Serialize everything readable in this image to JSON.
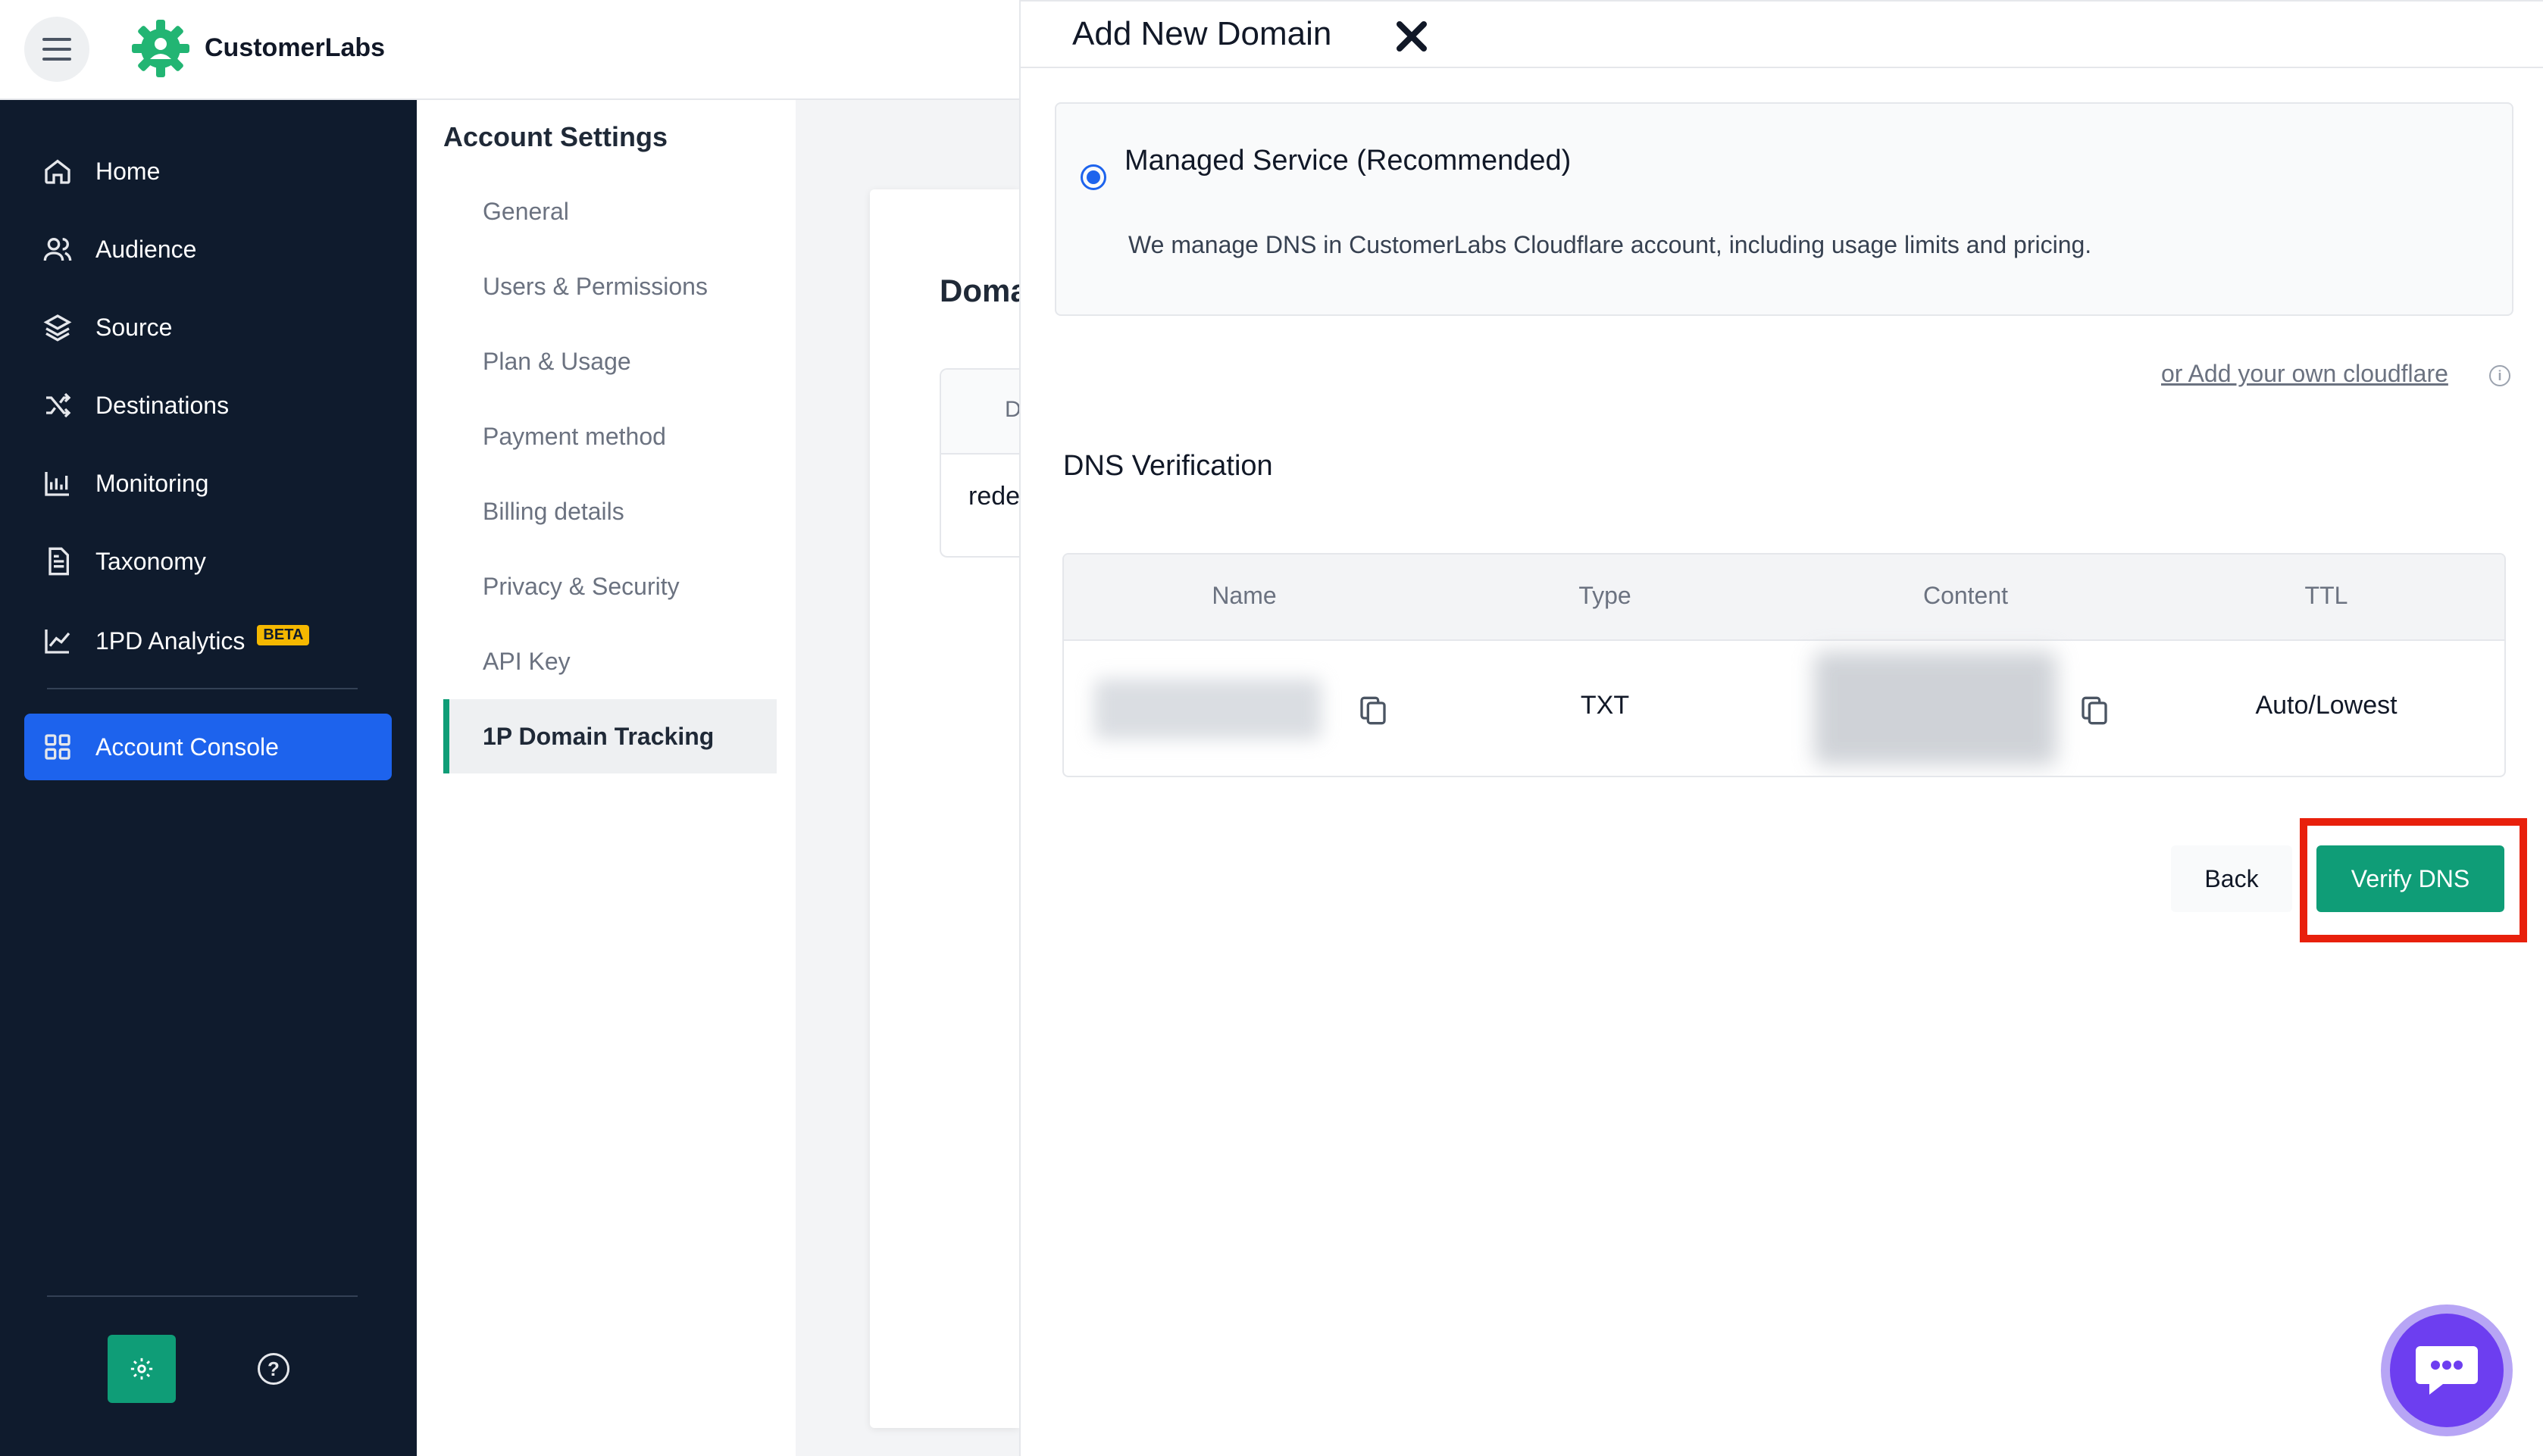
{
  "app": {
    "brand_name": "CustomerLabs",
    "accent_color": "#0f9d77",
    "primary_color": "#1d63ed",
    "sidebar_color": "#0f1b2d"
  },
  "sidebar": {
    "items": [
      {
        "label": "Home",
        "icon": "home-icon"
      },
      {
        "label": "Audience",
        "icon": "users-icon"
      },
      {
        "label": "Source",
        "icon": "layers-icon"
      },
      {
        "label": "Destinations",
        "icon": "shuffle-icon"
      },
      {
        "label": "Monitoring",
        "icon": "chart-bars-icon"
      },
      {
        "label": "Taxonomy",
        "icon": "document-icon"
      },
      {
        "label": "1PD Analytics",
        "icon": "line-chart-icon",
        "badge": "BETA"
      },
      {
        "label": "Account Console",
        "icon": "grid-icon",
        "active": true
      }
    ],
    "footer": {
      "settings_icon": "gear-icon",
      "help_icon": "help-icon",
      "help_glyph": "?"
    }
  },
  "settings_menu": {
    "title": "Account Settings",
    "items": [
      {
        "label": "General"
      },
      {
        "label": "Users & Permissions"
      },
      {
        "label": "Plan & Usage"
      },
      {
        "label": "Payment method"
      },
      {
        "label": "Billing details"
      },
      {
        "label": "Privacy & Security"
      },
      {
        "label": "API Key"
      },
      {
        "label": "1P Domain Tracking",
        "active": true
      }
    ]
  },
  "background_page": {
    "heading": "Doma",
    "table_header_first": "D",
    "table_row_first": "rede"
  },
  "modal": {
    "title": "Add New Domain",
    "managed_service": {
      "label": "Managed Service (Recommended)",
      "description": "We manage DNS in CustomerLabs Cloudflare account, including usage limits and pricing.",
      "selected": true
    },
    "own_cloudflare_link": "or Add your own cloudflare",
    "info_glyph": "i",
    "dns_verification": {
      "title": "DNS Verification",
      "columns": [
        "Name",
        "Type",
        "Content",
        "TTL"
      ],
      "rows": [
        {
          "name": "",
          "type": "TXT",
          "content": "",
          "ttl": "Auto/Lowest"
        }
      ]
    },
    "back_label": "Back",
    "verify_label": "Verify DNS"
  }
}
